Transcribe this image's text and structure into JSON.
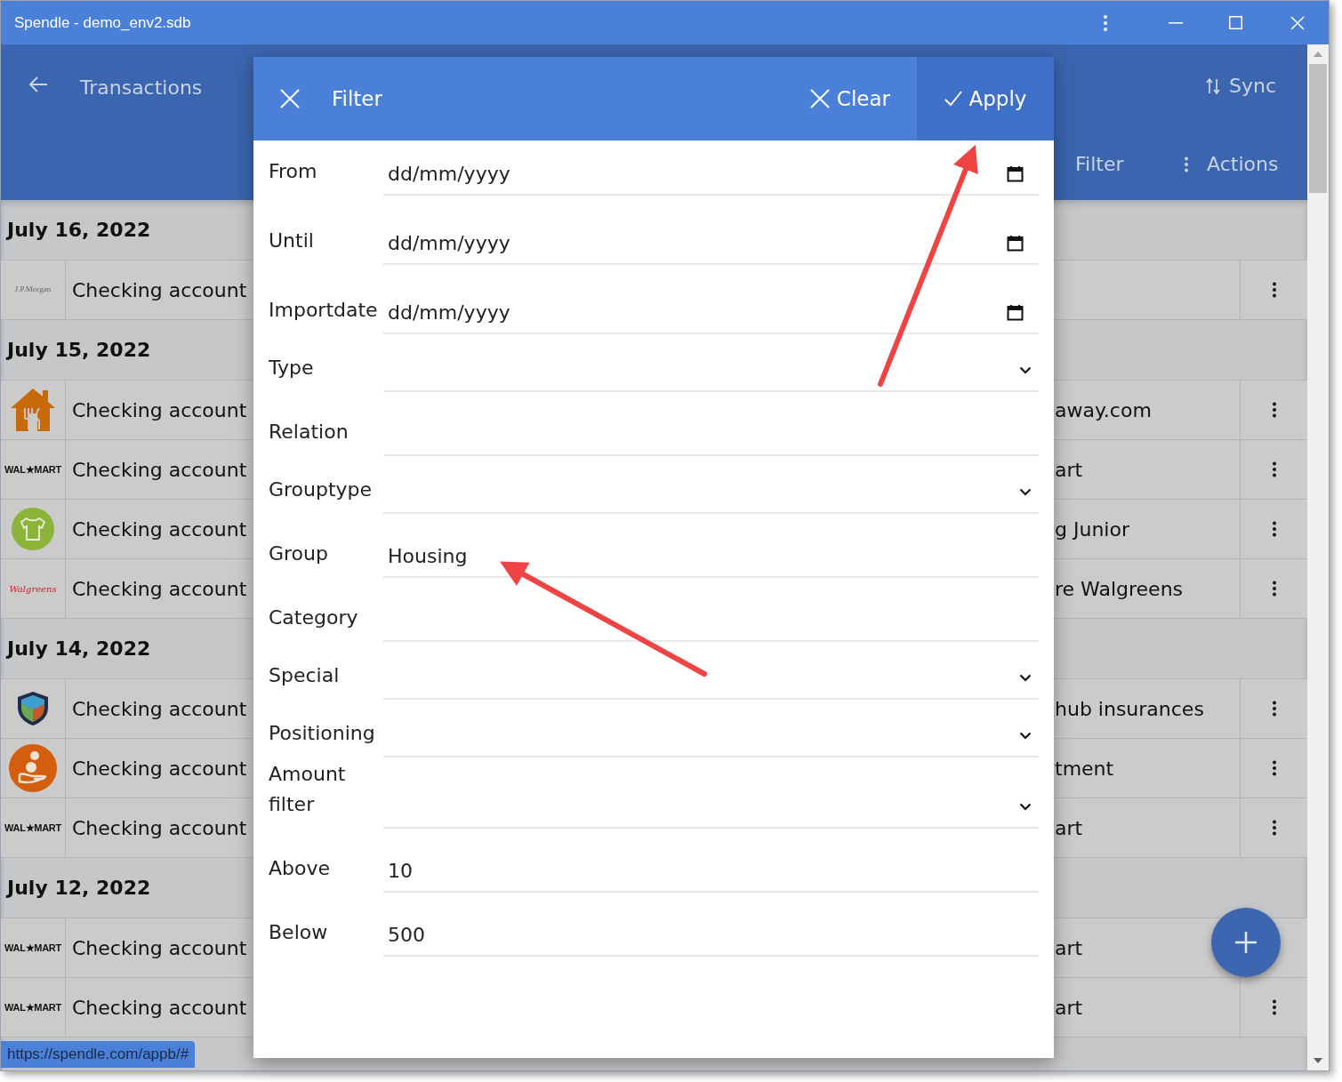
{
  "window": {
    "title": "Spendle - demo_env2.sdb"
  },
  "app_bar": {
    "title": "Transactions",
    "sync": "Sync",
    "filter": "Filter",
    "actions": "Actions"
  },
  "groups": [
    {
      "date": "July 16, 2022",
      "rows": [
        {
          "logo": {
            "kind": "serif-wordmark",
            "text": "J.P.Morgan"
          },
          "account": "Checking account",
          "column_3": "",
          "menu": true
        }
      ]
    },
    {
      "date": "July 15, 2022",
      "rows": [
        {
          "logo": {
            "kind": "house"
          },
          "account": "Checking account",
          "column_3": "away.com",
          "menu": true
        },
        {
          "logo": {
            "kind": "bold-wordmark",
            "text": "WAL★MART"
          },
          "account": "Checking account",
          "column_3": "art",
          "menu": true
        },
        {
          "logo": {
            "kind": "shirt"
          },
          "account": "Checking account",
          "column_3": "g Junior",
          "menu": true
        },
        {
          "logo": {
            "kind": "script-wordmark",
            "text": "Walgreens"
          },
          "account": "Checking account",
          "column_3": "re Walgreens",
          "menu": true
        }
      ]
    },
    {
      "date": "July 14, 2022",
      "rows": [
        {
          "logo": {
            "kind": "shield"
          },
          "account": "Checking account",
          "column_3": "hub insurances",
          "menu": true
        },
        {
          "logo": {
            "kind": "hand"
          },
          "account": "Checking account",
          "column_3": "tment",
          "menu": true
        },
        {
          "logo": {
            "kind": "bold-wordmark",
            "text": "WAL★MART"
          },
          "account": "Checking account",
          "column_3": "art",
          "menu": true
        }
      ]
    },
    {
      "date": "July 12, 2022",
      "rows": [
        {
          "logo": {
            "kind": "bold-wordmark",
            "text": "WAL★MART"
          },
          "account": "Checking account",
          "column_3": "art",
          "menu": false
        },
        {
          "logo": {
            "kind": "bold-wordmark",
            "text": "WAL★MART"
          },
          "account": "Checking account",
          "column_3": "art",
          "menu": true
        }
      ]
    }
  ],
  "status_url": "https://spendle.com/appb/#",
  "filter_dialog": {
    "title": "Filter",
    "clear": "Clear",
    "apply": "Apply",
    "fields": [
      {
        "label": "From",
        "kind": "date",
        "placeholder": "dd/mm/yyyy"
      },
      {
        "label": "Until",
        "kind": "date",
        "placeholder": "dd/mm/yyyy"
      },
      {
        "label": "Importdate",
        "kind": "date",
        "placeholder": "dd/mm/yyyy"
      },
      {
        "label": "Type",
        "kind": "select"
      },
      {
        "label": "Relation",
        "kind": "text"
      },
      {
        "label": "Grouptype",
        "kind": "select"
      },
      {
        "label": "Group",
        "kind": "text",
        "value": "Housing"
      },
      {
        "label": "Category",
        "kind": "text"
      },
      {
        "label": "Special",
        "kind": "select"
      },
      {
        "label": "Positioning",
        "kind": "select"
      },
      {
        "label": "Amount filter",
        "kind": "select"
      },
      {
        "label": "Above",
        "kind": "text",
        "value": "10"
      },
      {
        "label": "Below",
        "kind": "text",
        "value": "500"
      }
    ]
  }
}
